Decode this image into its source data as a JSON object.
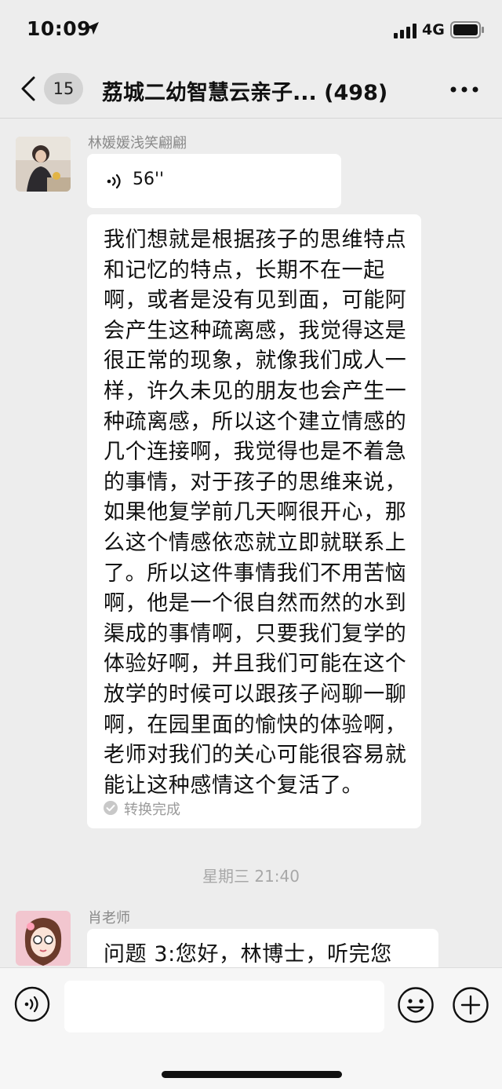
{
  "status_bar": {
    "time": "10:09",
    "network": "4G",
    "location_icon": "location-arrow-icon",
    "signal_icon": "cellular-signal-icon",
    "battery_icon": "battery-icon"
  },
  "nav": {
    "back_icon": "chevron-left-icon",
    "unread_count": "15",
    "title": "荔城二幼智慧云亲子... (498)",
    "more_icon": "more-dots-icon"
  },
  "messages": [
    {
      "sender": "林媛媛浅笑翩翩",
      "voice_duration": "56''",
      "transcript": "我们想就是根据孩子的思维特点和记忆的特点，长期不在一起啊，或者是没有见到面，可能阿会产生这种疏离感，我觉得这是很正常的现象，就像我们成人一样，许久未见的朋友也会产生一种疏离感，所以这个建立情感的几个连接啊，我觉得也是不着急的事情，对于孩子的思维来说，如果他复学前几天啊很开心，那么这个情感依恋就立即就联系上了。所以这件事情我们不用苦恼啊，他是一个很自然而然的水到渠成的事情啊，只要我们复学的体验好啊，并且我们可能在这个放学的时候可以跟孩子闷聊一聊啊，在园里面的愉快的体验啊，老师对我们的关心可能很容易就能让这种感情这个复活了。",
      "transcript_status": "转换完成"
    },
    {
      "sender": "肖老师",
      "text": "问题 3:您好，林博士，听完您"
    }
  ],
  "time_divider": "星期三 21:40",
  "input_bar": {
    "voice_icon": "voice-input-icon",
    "emoji_icon": "emoji-icon",
    "plus_icon": "plus-icon",
    "input_value": ""
  }
}
